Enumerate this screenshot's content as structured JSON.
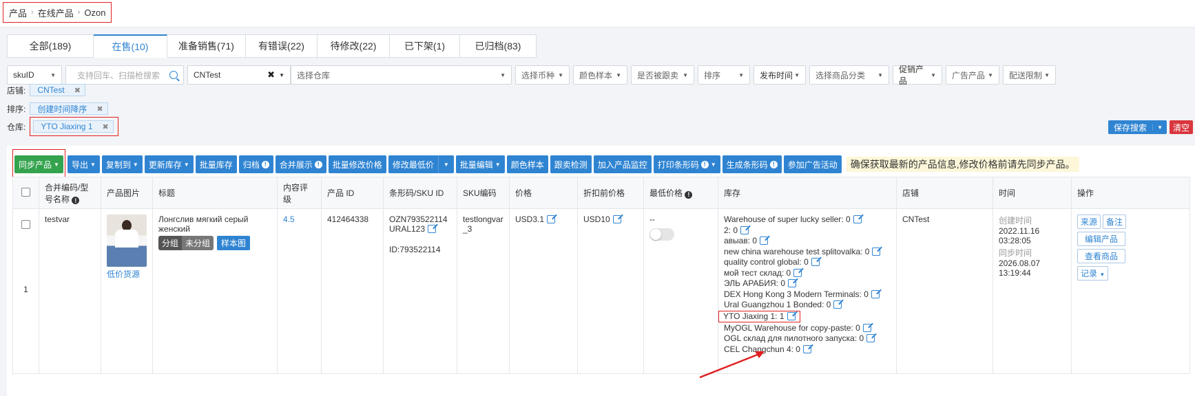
{
  "breadcrumb": [
    "产品",
    "在线产品",
    "Ozon"
  ],
  "tabs": [
    {
      "label": "全部(189)",
      "active": false
    },
    {
      "label": "在售(10)",
      "active": true
    },
    {
      "label": "准备销售(71)",
      "active": false
    },
    {
      "label": "有错误(22)",
      "active": false
    },
    {
      "label": "待修改(22)",
      "active": false
    },
    {
      "label": "已下架(1)",
      "active": false
    },
    {
      "label": "已归档(83)",
      "active": false
    }
  ],
  "filters": {
    "sku_type": "skuID",
    "search_placeholder": "支持回车、扫描枪搜索",
    "store_value": "CNTest",
    "warehouse_placeholder": "选择仓库",
    "currency": "选择币种",
    "color_sample": "颜色样本",
    "tracked": "是否被跟卖",
    "sort": "排序",
    "publish_time": "发布时间",
    "category": "选择商品分类",
    "promo": "促销产品",
    "ad": "广告产品",
    "delivery": "配送限制"
  },
  "active_filters": {
    "store_label": "店铺:",
    "store_value": "CNTest",
    "sort_label": "排序:",
    "sort_value": "创建时间降序",
    "warehouse_label": "仓库:",
    "warehouse_value": "YTO Jiaxing 1"
  },
  "actions": {
    "save_search": "保存搜索",
    "clear": "清空"
  },
  "toolbar": {
    "sync": "同步产品",
    "export": "导出",
    "copy_to": "复制到",
    "update_stock": "更新库存",
    "bulk_stock": "批量库存",
    "archive": "归档",
    "merge_display": "合并展示",
    "bulk_price": "批量修改价格",
    "min_price": "修改最低价",
    "bulk_edit": "批量编辑",
    "color_sample": "颜色样本",
    "follow_check": "跟卖检测",
    "add_monitor": "加入产品监控",
    "print_barcode": "打印条形码",
    "gen_barcode": "生成条形码",
    "join_ad": "参加广告活动",
    "notice": "确保获取最新的产品信息,修改价格前请先同步产品。"
  },
  "columns": {
    "merge_code": "合并编码/型号名称",
    "image": "产品图片",
    "title": "标题",
    "rating": "内容评级",
    "product_id": "产品 ID",
    "barcode": "条形码/SKU ID",
    "sku_code": "SKU编码",
    "price": "价格",
    "price_before": "折扣前价格",
    "min_price": "最低价格",
    "stock": "库存",
    "store": "店铺",
    "time": "时间",
    "ops": "操作"
  },
  "row": {
    "index": "1",
    "merge_code": "testvar",
    "image_link": "低价货源",
    "title": "Лонгслив мягкий серый женский",
    "group_label": "分组",
    "group_value": "未分组",
    "sample_img": "样本图",
    "rating": "4.5",
    "product_id": "412464338",
    "barcode_line1": "OZN793522114",
    "barcode_line2": "URAL123",
    "sku_id": "ID:793522114",
    "sku_code": "testlongvar_3",
    "price": "USD3.1",
    "price_before": "USD10",
    "min_price": "--",
    "stock": [
      "Warehouse of super lucky seller:  0",
      "2:  0",
      "авыав:  0",
      "new china warehouse test splitovalka:  0",
      "quality control global:  0",
      "мой тест склад:  0",
      "ЭЛЬ АРАБИЯ:  0",
      "DEX Hong Kong 3 Modern Terminals:  0",
      "Ural Guangzhou 1 Bonded:  0",
      "YTO Jiaxing 1:  1",
      "MyOGL Warehouse for copy-paste:  0",
      "OGL склад для пилотного запуска:  0",
      "CEL Changchun 4:  0"
    ],
    "store": "CNTest",
    "created_label": "创建时间",
    "created_value": "2022.11.16 03:28:05",
    "synced_label": "同步时间",
    "synced_value": "2026.08.07 13:19:44",
    "op_source": "来源",
    "op_note": "备注",
    "op_edit": "编辑产品",
    "op_view": "查看商品",
    "op_log": "记录"
  }
}
